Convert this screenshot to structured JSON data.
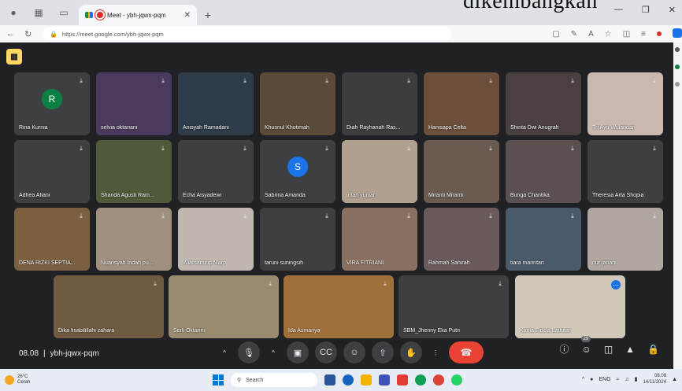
{
  "caption": "dikembangkan",
  "browser": {
    "tab_title": "Meet - ybh-jqwx-pqm",
    "url": "https://meet.google.com/ybh-jqwx-pqm"
  },
  "participants": [
    {
      "name": "Rina Kurnia",
      "avatar": "R",
      "avatar_color": "#0b8043"
    },
    {
      "name": "selvia oktariani"
    },
    {
      "name": "Anisyah Ramadani"
    },
    {
      "name": "Khusnul Khotimah"
    },
    {
      "name": "Diah Rayhanah Ras..."
    },
    {
      "name": "Hanisapa Celta"
    },
    {
      "name": "Shinta Dwi Anugrah"
    },
    {
      "name": "Tri Ayu Wulandari"
    },
    {
      "name": "Adhea Afiani"
    },
    {
      "name": "Shanda Agusti Ram..."
    },
    {
      "name": "Echa Aisyadewi"
    },
    {
      "name": "Sabrina Amanda",
      "avatar": "S",
      "avatar_color": "#1a73e8"
    },
    {
      "name": "intan yuniar"
    },
    {
      "name": "Miranti Miranti"
    },
    {
      "name": "Bunga Chantika"
    },
    {
      "name": "Theresia Arta Shopia"
    },
    {
      "name": "DENA RIZKI SEPTIA..."
    },
    {
      "name": "Nuansyah Indah pu..."
    },
    {
      "name": "Wiarsamirip Marp"
    },
    {
      "name": "taruni suningsih"
    },
    {
      "name": "VIRA FITRIANI"
    },
    {
      "name": "Rahmah Sahirah"
    },
    {
      "name": "tiara marintan"
    },
    {
      "name": "nur janah"
    },
    {
      "name": "Dika fisabilillahi zahara"
    },
    {
      "name": "Serli Oktarini"
    },
    {
      "name": "Ida Asmariya"
    },
    {
      "name": "SBM_Jhenny Eka Putri"
    },
    {
      "name": "Kania Fidela Lathifah"
    }
  ],
  "meeting": {
    "time": "08.08",
    "separator": "|",
    "code": "ybh-jqwx-pqm",
    "people_count": "29"
  },
  "taskbar": {
    "weather_temp": "26°C",
    "weather_desc": "Cerah",
    "search_placeholder": "Search",
    "lang": "ENG",
    "clock_time": "08.08",
    "clock_date": "14/11/2024"
  }
}
